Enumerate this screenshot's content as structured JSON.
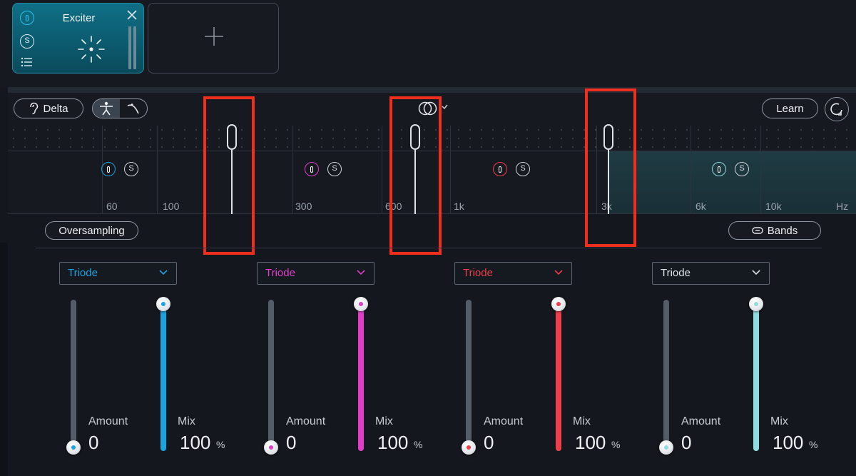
{
  "module": {
    "title": "Exciter",
    "solo_label": "S"
  },
  "toolbar": {
    "delta_label": "Delta",
    "learn_label": "Learn",
    "oversampling_label": "Oversampling",
    "bands_label": "Bands"
  },
  "frequency_labels": [
    "60",
    "100",
    "300",
    "600",
    "1k",
    "3k",
    "6k",
    "10k",
    "Hz"
  ],
  "band_solo_label": "S",
  "colors": {
    "band1": "#1aa3de",
    "band2": "#e03ec8",
    "band3": "#ee3e4a",
    "band4": "#8fdbe0",
    "highlight": "#ef2e1e"
  },
  "bands": [
    {
      "mode": "Triode",
      "amount_label": "Amount",
      "amount": "0",
      "mix_label": "Mix",
      "mix": "100",
      "mix_unit": "%",
      "amount_level": 0.0,
      "mix_level": 1.0
    },
    {
      "mode": "Triode",
      "amount_label": "Amount",
      "amount": "0",
      "mix_label": "Mix",
      "mix": "100",
      "mix_unit": "%",
      "amount_level": 0.0,
      "mix_level": 1.0
    },
    {
      "mode": "Triode",
      "amount_label": "Amount",
      "amount": "0",
      "mix_label": "Mix",
      "mix": "100",
      "mix_unit": "%",
      "amount_level": 0.0,
      "mix_level": 1.0
    },
    {
      "mode": "Triode",
      "amount_label": "Amount",
      "amount": "0",
      "mix_label": "Mix",
      "mix": "100",
      "mix_unit": "%",
      "amount_level": 0.0,
      "mix_level": 1.0
    }
  ]
}
